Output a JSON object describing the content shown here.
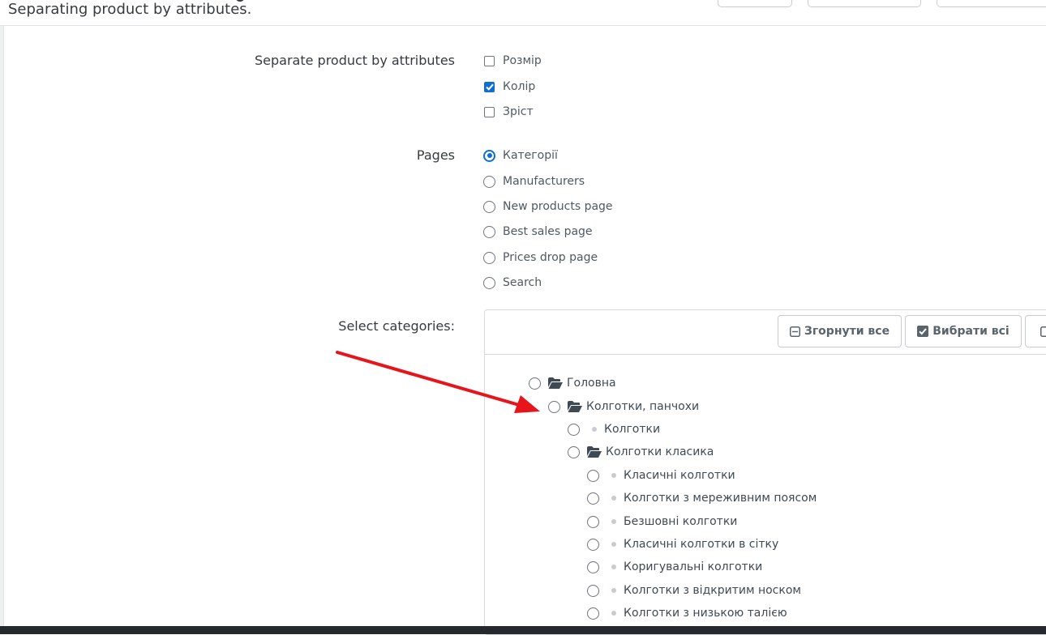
{
  "header": {
    "subtitle": "Separating product by attributes."
  },
  "form": {
    "separate_label": "Separate product by attributes",
    "attributes": [
      {
        "label": "Розмір",
        "checked": false
      },
      {
        "label": "Колір",
        "checked": true
      },
      {
        "label": "Зріст",
        "checked": false
      }
    ],
    "pages_label": "Pages",
    "pages": [
      {
        "label": "Категорії",
        "selected": true
      },
      {
        "label": "Manufacturers",
        "selected": false
      },
      {
        "label": "New products page",
        "selected": false
      },
      {
        "label": "Best sales page",
        "selected": false
      },
      {
        "label": "Prices drop page",
        "selected": false
      },
      {
        "label": "Search",
        "selected": false
      }
    ],
    "categories_label": "Select categories:"
  },
  "tree_toolbar": {
    "collapse_label": "Згорнути все",
    "select_all_label": "Вибрати всі"
  },
  "tree": [
    {
      "label": "Головна",
      "icon": "folder-open-icon",
      "level": 0
    },
    {
      "label": "Колготки, панчохи",
      "icon": "folder-open-icon",
      "level": 1
    },
    {
      "label": "Колготки",
      "icon": "bullet-icon",
      "level": 2
    },
    {
      "label": "Колготки класика",
      "icon": "folder-open-icon",
      "level": 2
    },
    {
      "label": "Класичні колготки",
      "icon": "bullet-icon",
      "level": 3
    },
    {
      "label": "Колготки з мереживним поясом",
      "icon": "bullet-icon",
      "level": 3
    },
    {
      "label": "Безшовні колготки",
      "icon": "bullet-icon",
      "level": 3
    },
    {
      "label": "Класичні колготки в сітку",
      "icon": "bullet-icon",
      "level": 3
    },
    {
      "label": "Коригувальні колготки",
      "icon": "bullet-icon",
      "level": 3
    },
    {
      "label": "Колготки з відкритим носком",
      "icon": "bullet-icon",
      "level": 3
    },
    {
      "label": "Колготки з низькою талією",
      "icon": "bullet-icon",
      "level": 3
    }
  ],
  "colors": {
    "accent": "#0e6ecf",
    "arrow": "#e8141b"
  }
}
